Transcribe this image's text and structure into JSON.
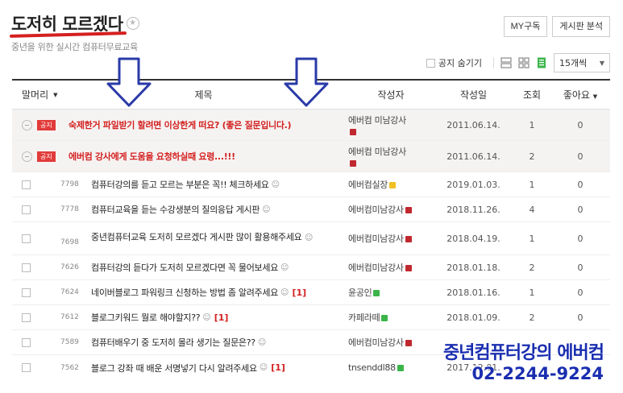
{
  "board": {
    "title": "도저히 모르겠다",
    "subtitle": "중년을 위한 실시간 컴퓨터무료교육",
    "my_subscribe_label": "MY구독",
    "board_analysis_label": "게시판 분석",
    "hide_notice_label": "공지 숨기기",
    "per_page": "15개씩"
  },
  "columns": {
    "head": "말머리",
    "title": "제목",
    "author": "작성자",
    "date": "작성일",
    "views": "조회",
    "likes": "좋아요"
  },
  "notices": [
    {
      "badge": "공지",
      "title": "숙제한거 파일받기 할려면 이상한게 떠요? (좋은 질문입니다.)",
      "author": "에버컴 미남강사",
      "date": "2011.06.14.",
      "views": "1",
      "likes": "0"
    },
    {
      "badge": "공지",
      "title": "에버컴 강사에게 도움을 요청하실때 요령...!!!",
      "author": "에버컴 미남강사",
      "date": "2011.06.14.",
      "views": "2",
      "likes": "0"
    }
  ],
  "posts": [
    {
      "no": "7798",
      "title": "컴퓨터강의를 듣고 모르는 부분은 꼭!! 체크하세요",
      "comments": "",
      "author": "에버컴실장",
      "date": "2019.01.03.",
      "views": "1",
      "likes": "0"
    },
    {
      "no": "7778",
      "title": "컴퓨터교육을 듣는 수강생분의 질의응답 게시판",
      "comments": "",
      "author": "에버컴미남강사",
      "date": "2018.11.26.",
      "views": "4",
      "likes": "0"
    },
    {
      "no": "7698",
      "title": "중년컴퓨터교육 도저히 모르겠다 게시판 많이 활용해주세요",
      "comments": "",
      "author": "에버컴미남강사",
      "date": "2018.04.19.",
      "views": "1",
      "likes": "0"
    },
    {
      "no": "7626",
      "title": "컴퓨터강의 듣다가 도저히 모르겠다면 꼭 물어보세요",
      "comments": "",
      "author": "에버컴미남강사",
      "date": "2018.01.18.",
      "views": "2",
      "likes": "0"
    },
    {
      "no": "7624",
      "title": "네이버블로그 파워링크 신청하는 방법 좀 알려주세요",
      "comments": "[1]",
      "author": "윤공인",
      "date": "2018.01.16.",
      "views": "1",
      "likes": "0"
    },
    {
      "no": "7612",
      "title": "블로그키워드 뭘로 해야할지??",
      "comments": "[1]",
      "author": "카페라떼",
      "date": "2018.01.09.",
      "views": "2",
      "likes": "0"
    },
    {
      "no": "7589",
      "title": "컴퓨터배우기 중 도저히 몰라 생기는 질문은??",
      "comments": "",
      "author": "에버컴미남강사",
      "date": "",
      "views": "",
      "likes": ""
    },
    {
      "no": "7562",
      "title": "블로그 강좌 때 배운 서명넣기 다시 알려주세요",
      "comments": "[1]",
      "author": "tnsenddl88",
      "date": "2017.12.01.",
      "views": "",
      "likes": ""
    }
  ],
  "watermark": {
    "line1": "중년컴퓨터강의 에버컴",
    "line2": "02-2244-9224"
  },
  "colors": {
    "accent_red": "#d42020",
    "arrow_blue": "#2a3aa8",
    "watermark_blue": "#1a2eb0"
  }
}
